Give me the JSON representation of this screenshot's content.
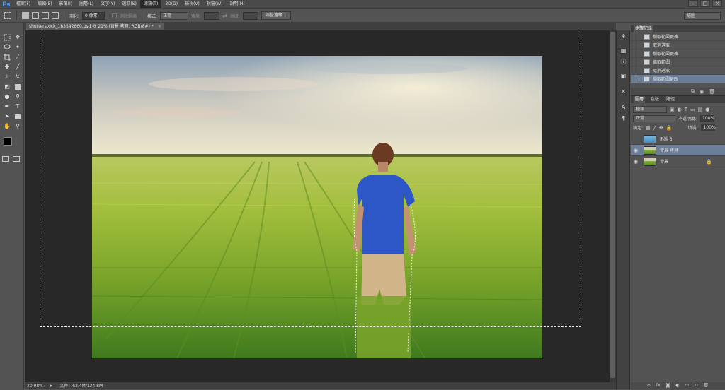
{
  "app": {
    "logo": "Ps"
  },
  "menu": [
    "檔案(F)",
    "編輯(E)",
    "影像(I)",
    "圖層(L)",
    "文字(Y)",
    "選取(S)",
    "濾鏡(T)",
    "3D(D)",
    "檢視(V)",
    "視窗(W)",
    "說明(H)"
  ],
  "window_controls": [
    "–",
    "□",
    "×"
  ],
  "options": {
    "feather_label": "羽化:",
    "feather_value": "0 像素",
    "antialias_label": "消除鋸齒",
    "style_label": "樣式:",
    "style_value": "正常",
    "width_label": "寬度:",
    "height_label": "高度:",
    "refine_button": "調整邊緣...",
    "workspace": "繪圖"
  },
  "document": {
    "tab_title": "shutterstock_183542660.psd @ 21% (背景 拷貝, RGB/8#) *",
    "tab_close": "×"
  },
  "status": {
    "zoom": "20.98%",
    "doc_size": "文件：62.4M/124.8M"
  },
  "history": {
    "tabs": [
      "步驟記錄"
    ],
    "items": [
      {
        "label": "擷取範圍更改",
        "selected": false
      },
      {
        "label": "取消選取",
        "selected": false
      },
      {
        "label": "擷取範圍更改",
        "selected": false
      },
      {
        "label": "擴取範圍",
        "selected": false
      },
      {
        "label": "取消選取",
        "selected": false
      },
      {
        "label": "擷取範圍更改",
        "selected": true
      }
    ]
  },
  "layers": {
    "tabs": [
      "圖層",
      "色版",
      "路徑"
    ],
    "filter_kind": "種類",
    "blend_mode": "正常",
    "opacity_label": "不透明度:",
    "opacity_value": "100%",
    "lock_label": "鎖定:",
    "fill_label": "填滿:",
    "fill_value": "100%",
    "items": [
      {
        "name": "形狀 3",
        "visible": false,
        "selected": false,
        "locked": false,
        "thumb": "shape"
      },
      {
        "name": "背景 拷貝",
        "visible": true,
        "selected": true,
        "locked": false,
        "thumb": "photo"
      },
      {
        "name": "背景",
        "visible": true,
        "selected": false,
        "locked": true,
        "thumb": "photo"
      }
    ],
    "footer_icons": [
      "link-icon",
      "fx-icon",
      "mask-icon",
      "adjustment-icon",
      "folder-icon",
      "new-layer-icon",
      "trash-icon"
    ]
  },
  "colors": {
    "accent_selected": "#6c7d97",
    "foreground": "#000000",
    "background": "#ffffff"
  }
}
